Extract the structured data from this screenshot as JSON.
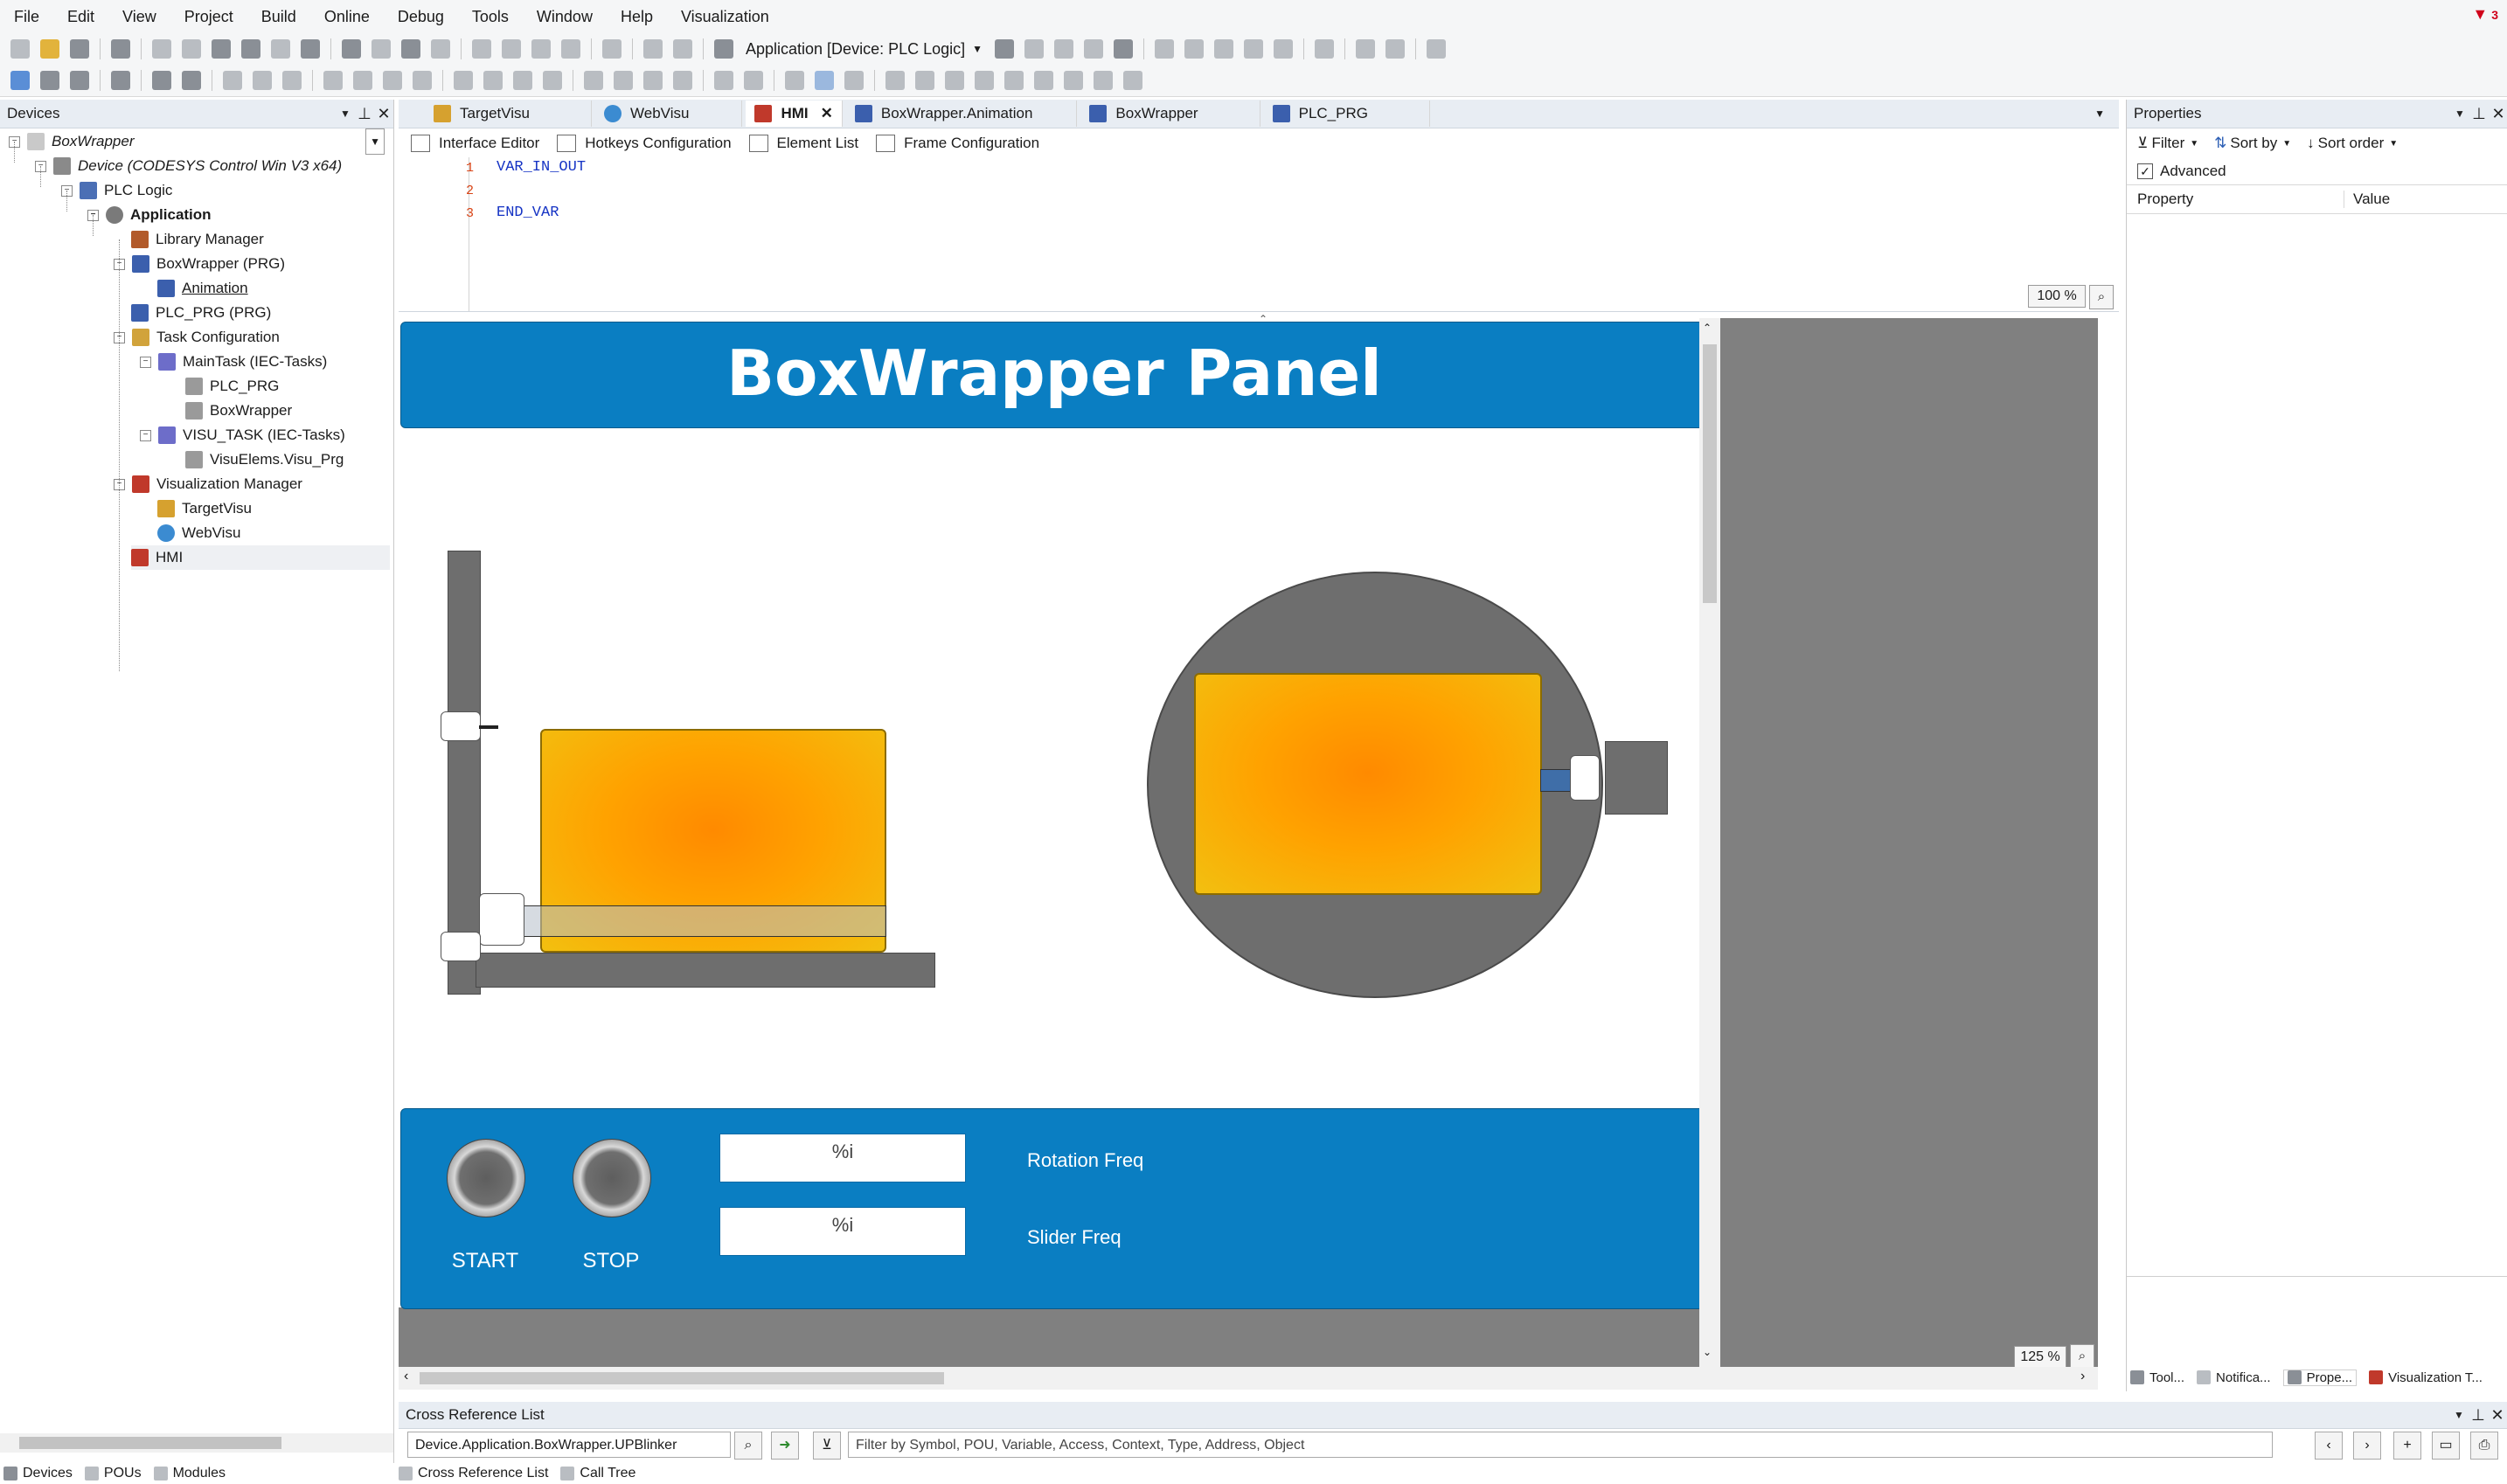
{
  "menu": [
    "File",
    "Edit",
    "View",
    "Project",
    "Build",
    "Online",
    "Debug",
    "Tools",
    "Window",
    "Help",
    "Visualization"
  ],
  "notification_count": "3",
  "toolbar": {
    "application_selector": "Application [Device: PLC Logic]"
  },
  "devices_panel": {
    "title": "Devices",
    "tree": [
      {
        "label": "BoxWrapper",
        "italic": true
      },
      {
        "label": "Device (CODESYS Control Win V3 x64)",
        "italic": true
      },
      {
        "label": "PLC Logic"
      },
      {
        "label": "Application",
        "bold": true
      },
      {
        "label": "Library Manager"
      },
      {
        "label": "BoxWrapper (PRG)"
      },
      {
        "label": "Animation",
        "underline": true
      },
      {
        "label": "PLC_PRG (PRG)"
      },
      {
        "label": "Task Configuration"
      },
      {
        "label": "MainTask (IEC-Tasks)"
      },
      {
        "label": "PLC_PRG"
      },
      {
        "label": "BoxWrapper"
      },
      {
        "label": "VISU_TASK (IEC-Tasks)"
      },
      {
        "label": "VisuElems.Visu_Prg"
      },
      {
        "label": "Visualization Manager"
      },
      {
        "label": "TargetVisu"
      },
      {
        "label": "WebVisu"
      },
      {
        "label": "HMI"
      }
    ]
  },
  "editor_tabs": [
    "TargetVisu",
    "WebVisu",
    "HMI",
    "BoxWrapper.Animation",
    "BoxWrapper",
    "PLC_PRG"
  ],
  "editor_subtabs": [
    "Interface Editor",
    "Hotkeys Configuration",
    "Element List",
    "Frame Configuration"
  ],
  "code": {
    "lines": [
      {
        "num": "1",
        "text": "VAR_IN_OUT"
      },
      {
        "num": "2",
        "text": ""
      },
      {
        "num": "3",
        "text": "END_VAR"
      }
    ],
    "zoom": "100 %"
  },
  "visu": {
    "title": "BoxWrapper Panel",
    "start_label": "START",
    "stop_label": "STOP",
    "field1": "%i",
    "field2": "%i",
    "rotation_label": "Rotation Freq",
    "slider_label": "Slider Freq",
    "zoom": "125 %",
    "colors": {
      "panel_blue": "#0A7EC2",
      "box_orange": "#FFA200",
      "machine_gray": "#6E6E6E"
    }
  },
  "properties": {
    "title": "Properties",
    "filter": "Filter",
    "sort_by": "Sort by",
    "sort_order": "Sort order",
    "advanced": "Advanced",
    "col_property": "Property",
    "col_value": "Value",
    "bottom_tabs": [
      "Tool...",
      "Notifica...",
      "Prope...",
      "Visualization T..."
    ]
  },
  "cross_reference": {
    "title": "Cross Reference List",
    "input_value": "Device.Application.BoxWrapper.UPBlinker",
    "filter_placeholder": "Filter by Symbol, POU, Variable, Access, Context, Type, Address, Object",
    "bottom_tabs": [
      "Cross Reference List",
      "Call Tree"
    ]
  },
  "devices_bottom_tabs": [
    "Devices",
    "POUs",
    "Modules"
  ]
}
